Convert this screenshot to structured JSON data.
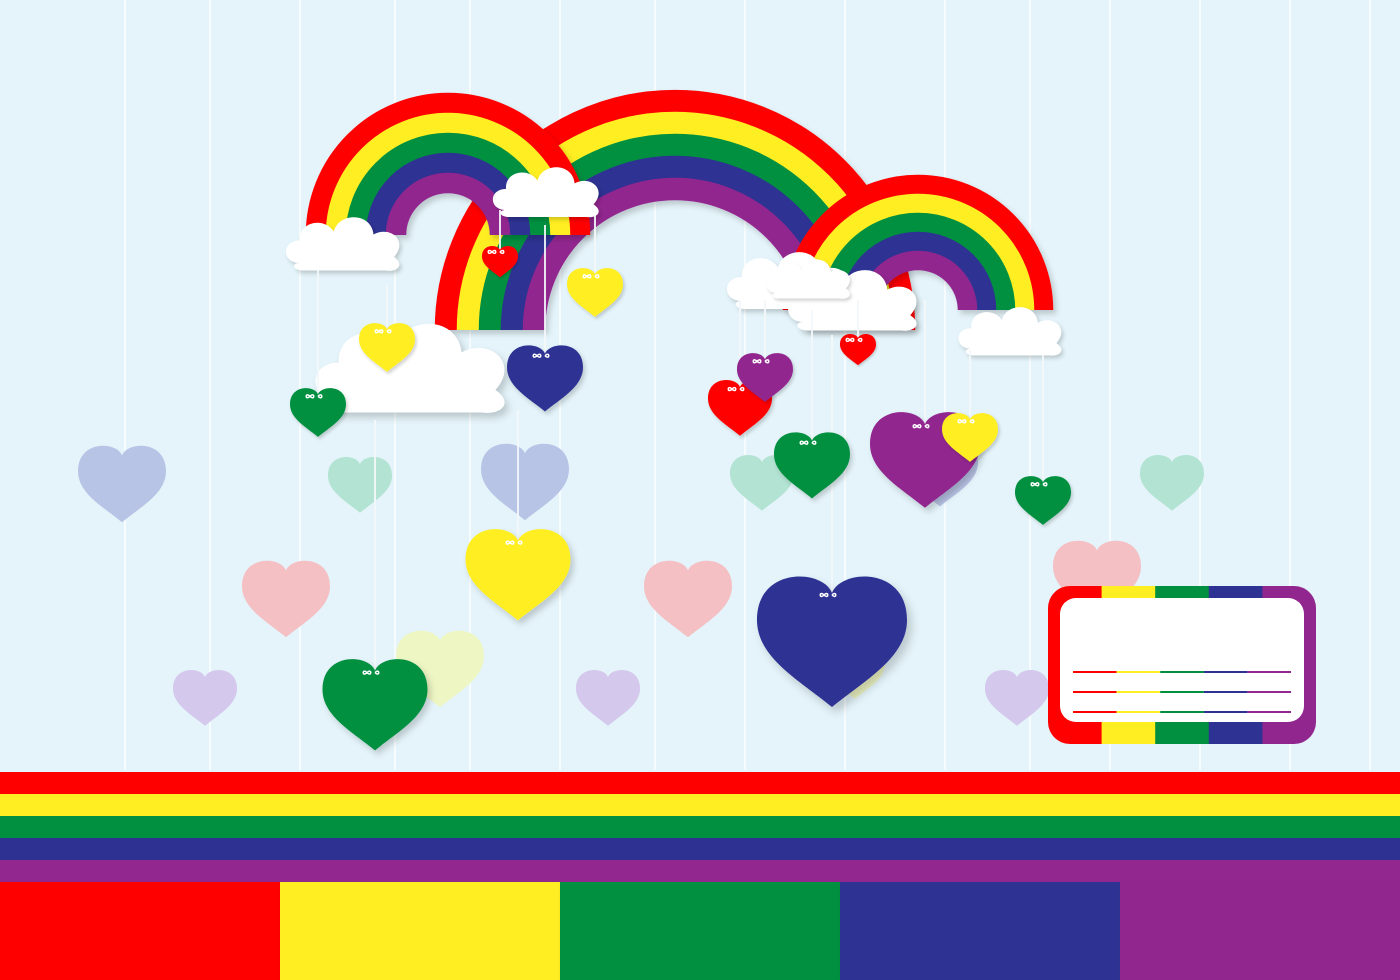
{
  "palette": {
    "background": "#e4f4fa",
    "red": "#ff0000",
    "yellow": "#ffee22",
    "green": "#009040",
    "blue": "#2e3192",
    "purple": "#92278f",
    "cloud": "#ffffff",
    "string": "#f4f8fa"
  },
  "icons": {
    "rainbow": "rainbow-icon",
    "cloud": "cloud-icon",
    "heart": "heart-icon",
    "label_card": "blank-label-card"
  },
  "label_card": {
    "text": "",
    "line_count": 3
  },
  "bottom_swatches": [
    "red",
    "yellow",
    "green",
    "blue",
    "purple"
  ]
}
